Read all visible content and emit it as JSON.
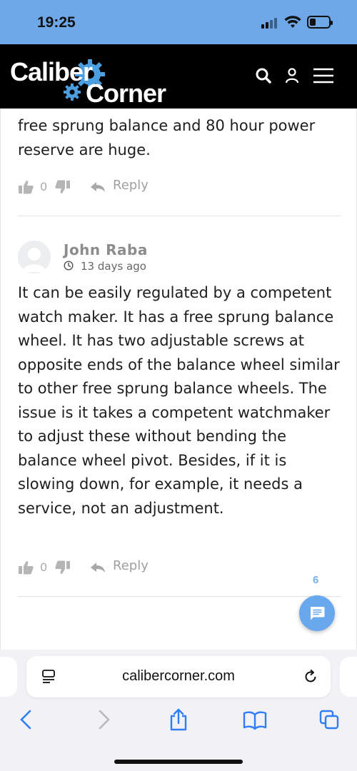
{
  "status_bar": {
    "time": "19:25"
  },
  "site": {
    "logo_word1": "Caliber",
    "logo_word2": "Corner",
    "icons": [
      "search-icon",
      "user-icon",
      "menu-icon"
    ]
  },
  "previous_comment": {
    "text": "free sprung balance and 80 hour power reserve are huge.",
    "likes": "0",
    "reply_label": "Reply"
  },
  "comment": {
    "author": "John Raba",
    "time_ago": "13 days ago",
    "text": "It can be easily regulated by a competent watch maker. It has a free sprung balance wheel. It has two adjustable screws at opposite ends of the balance wheel similar to other free sprung balance wheels. The issue is it takes a competent watchmaker to adjust these without bending the balance wheel pivot. Besides, if it is slowing down, for example, it needs a service, not an adjustment.",
    "likes": "0",
    "reply_label": "Reply"
  },
  "comments_fab": {
    "count": "6",
    "icon": "comment-icon"
  },
  "safari": {
    "url": "calibercorner.com",
    "toolbar": [
      "back-icon",
      "forward-icon",
      "share-icon",
      "bookmarks-icon",
      "tabs-icon"
    ]
  },
  "colors": {
    "status_bar_bg": "#6fa8e8",
    "header_bg": "#000000",
    "accent": "#68a8ec",
    "logo_gear": "#4b9ee0"
  }
}
